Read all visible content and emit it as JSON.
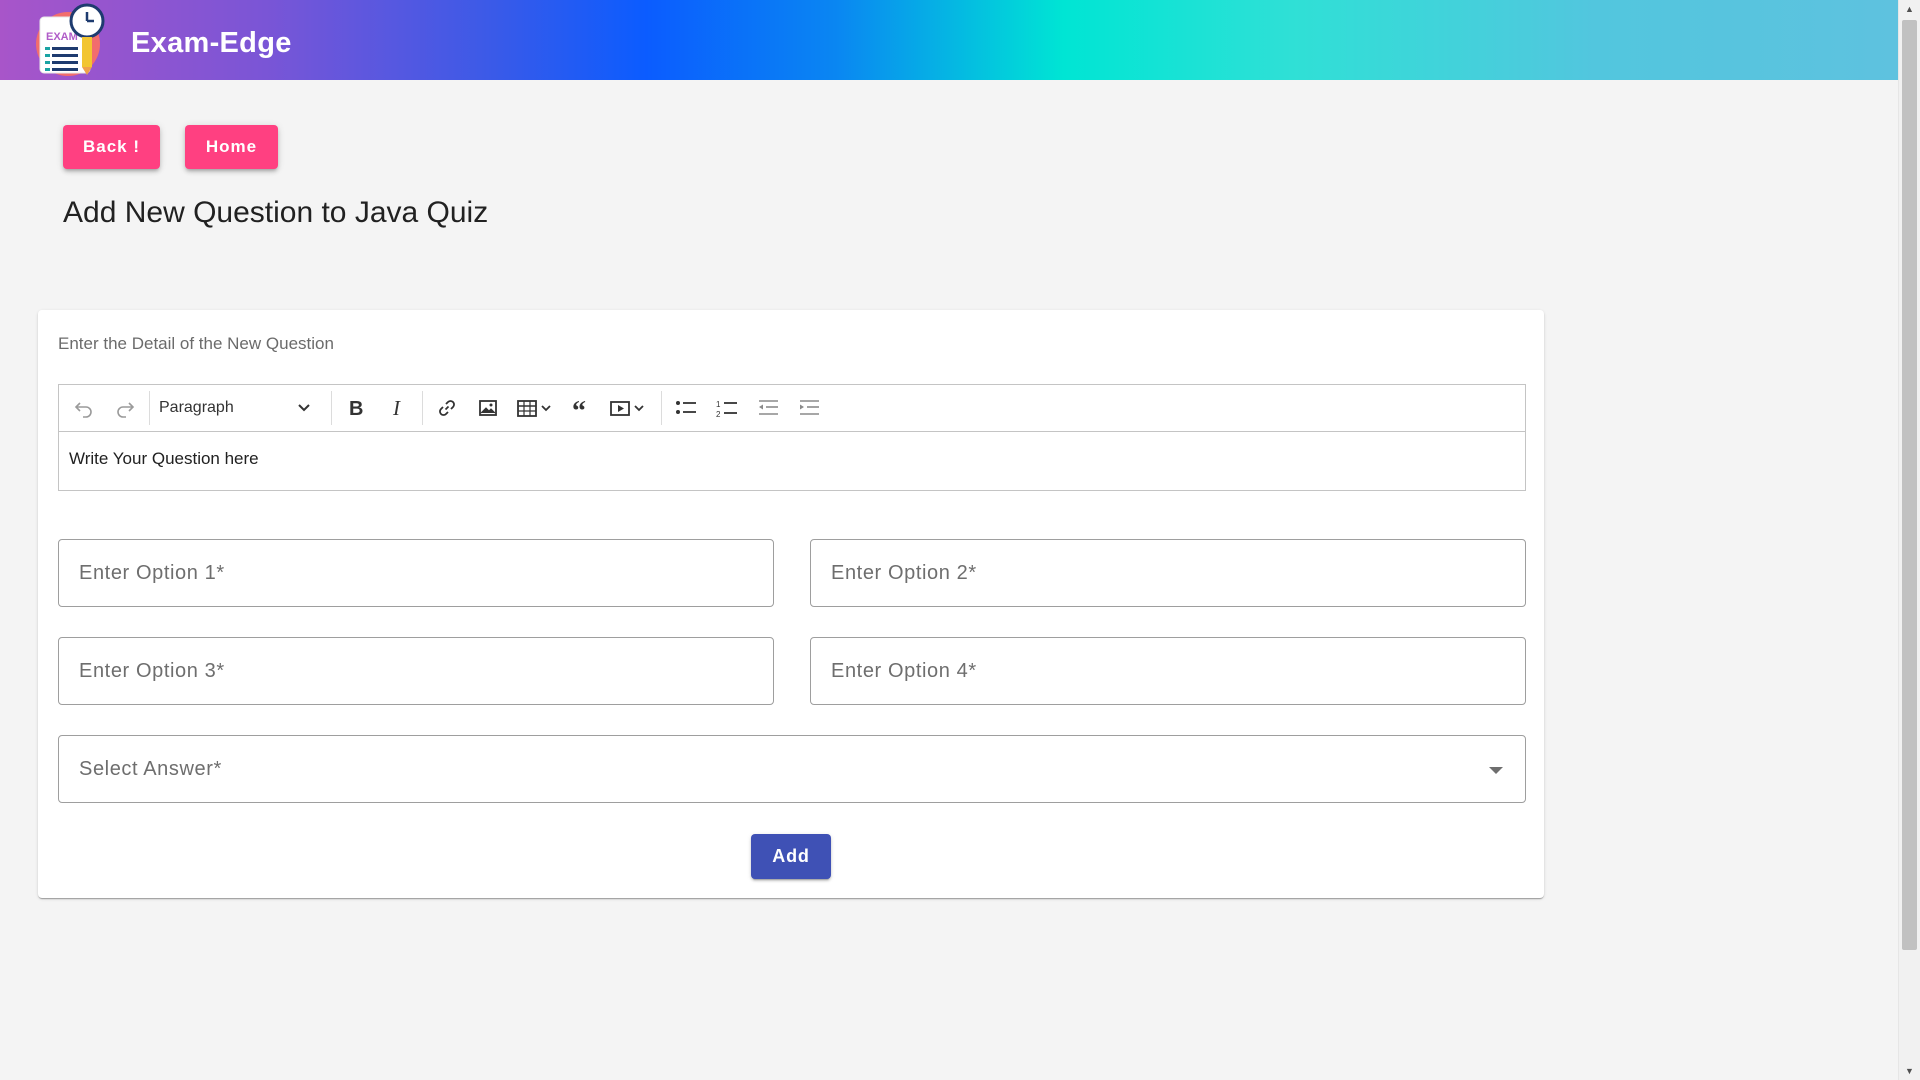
{
  "header": {
    "app_title": "Exam-Edge",
    "logo_text": "EXAM",
    "logo_icon": "exam-clock-pencil-logo"
  },
  "nav": {
    "back_label": "Back !",
    "home_label": "Home"
  },
  "page": {
    "title": "Add New Question to Java Quiz"
  },
  "form": {
    "subtitle": "Enter the Detail of the New Question",
    "editor": {
      "heading_select": "Paragraph",
      "content": "Write Your Question here",
      "toolbar_icons": [
        "undo-icon",
        "redo-icon",
        "bold-icon",
        "italic-icon",
        "link-icon",
        "image-icon",
        "table-icon",
        "blockquote-icon",
        "media-icon",
        "bulleted-list-icon",
        "numbered-list-icon",
        "outdent-icon",
        "indent-icon"
      ]
    },
    "option1_placeholder": "Enter Option 1*",
    "option2_placeholder": "Enter Option 2*",
    "option3_placeholder": "Enter Option 3*",
    "option4_placeholder": "Enter Option 4*",
    "answer_placeholder": "Select Answer*",
    "add_label": "Add"
  },
  "colors": {
    "accent_pink": "#ff4081",
    "primary": "#3f51b5",
    "background": "#f4f4f4"
  }
}
